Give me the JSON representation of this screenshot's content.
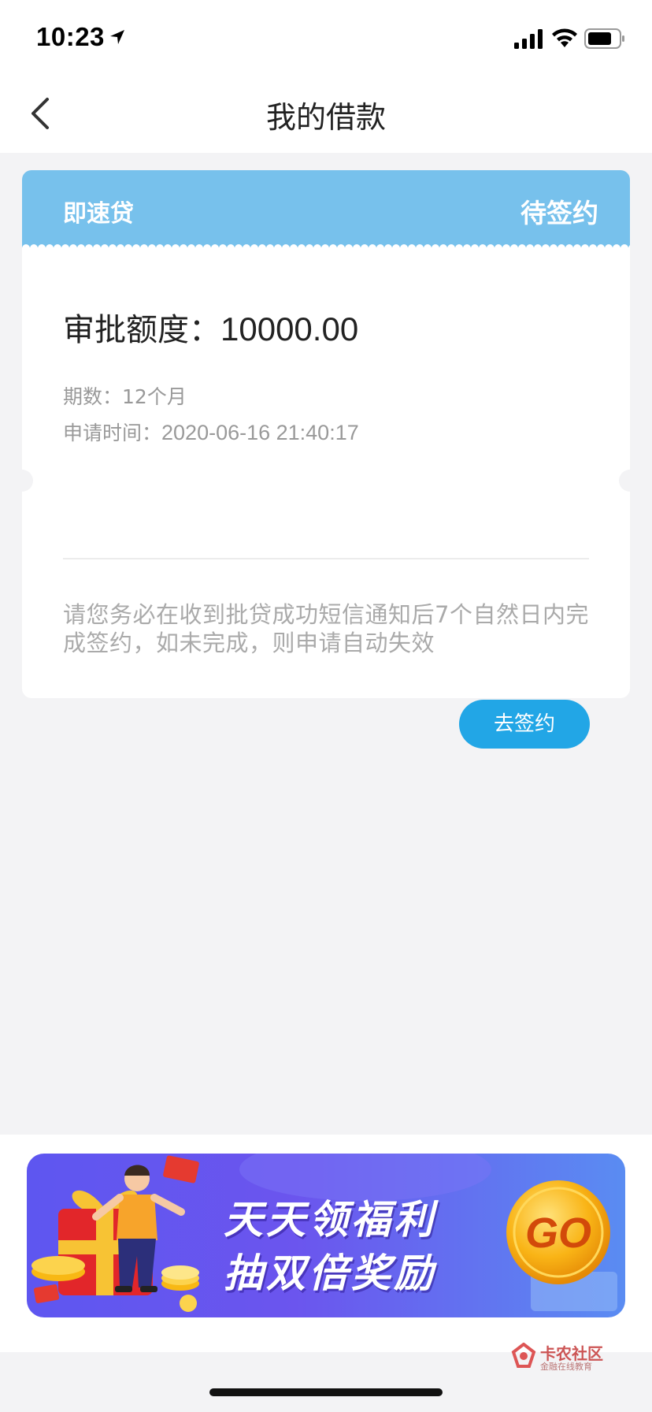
{
  "status_bar": {
    "time": "10:23"
  },
  "nav": {
    "title": "我的借款"
  },
  "loan": {
    "product_name": "即速贷",
    "status": "待签约",
    "amount_label": "审批额度：",
    "amount_value": "10000.00",
    "term_label": "期数：",
    "term_value": "12个月",
    "apply_time_label": "申请时间：",
    "apply_time_value": "2020-06-16 21:40:17",
    "notice": "请您务必在收到批贷成功短信通知后7个自然日内完成签约，如未完成，则申请自动失效",
    "sign_button_label": "去签约"
  },
  "promo": {
    "line1": "天天领福利",
    "line2": "抽双倍奖励",
    "go_label": "GO"
  },
  "watermark": {
    "title": "卡农社区",
    "subtitle": "金融在线教育"
  },
  "colors": {
    "header_blue": "#77c1ec",
    "button_blue": "#22a6e6",
    "banner_purple": "#5e56f0",
    "go_orange": "#f5a20a"
  },
  "icons": [
    "location-arrow-icon",
    "signal-icon",
    "wifi-icon",
    "battery-icon",
    "back-chevron-icon",
    "go-coin-icon"
  ]
}
